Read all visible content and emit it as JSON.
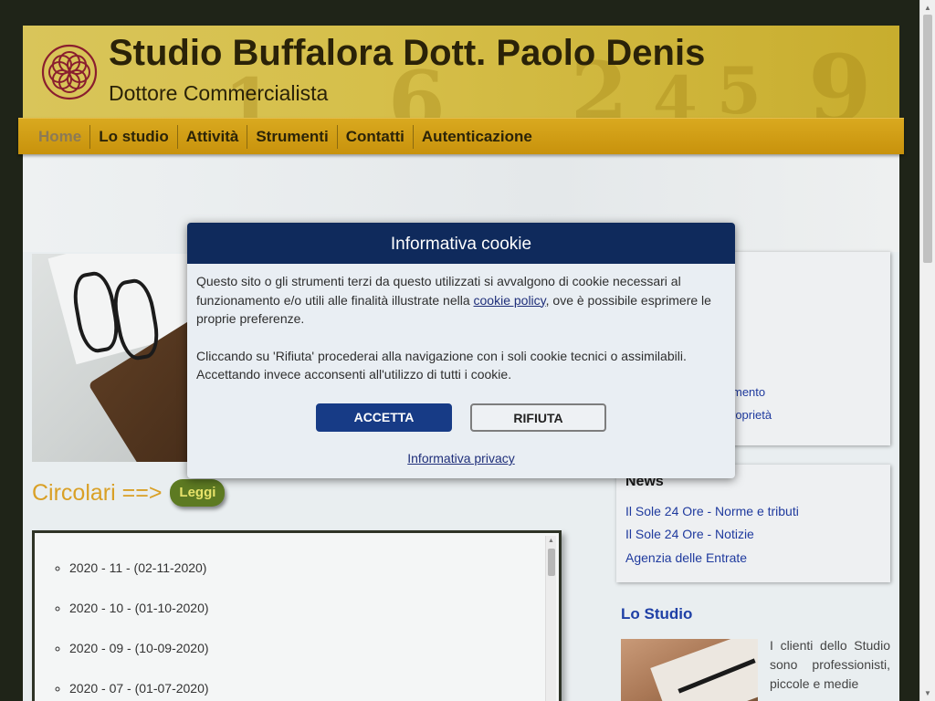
{
  "header": {
    "title": "Studio Buffalora Dott. Paolo Denis",
    "subtitle": "Dottore Commercialista"
  },
  "nav": {
    "items": [
      "Home",
      "Lo studio",
      "Attività",
      "Strumenti",
      "Contatti",
      "Autenticazione"
    ],
    "active": "Home"
  },
  "circolari": {
    "title": "Circolari ==>",
    "button": "Leggi",
    "items": [
      "2020 - 11 - (02-11-2020)",
      "2020 - 10 - (01-10-2020)",
      "2020 - 09 - (10-09-2020)",
      "2020 - 07 - (01-07-2020)"
    ]
  },
  "side_panel": {
    "links": [
      "mento",
      "roprietà"
    ]
  },
  "news": {
    "title": "News",
    "links": [
      "Il Sole 24 Ore - Norme e tributi",
      "Il Sole 24 Ore - Notizie",
      "Agenzia delle Entrate"
    ]
  },
  "lo_studio": {
    "title": "Lo Studio",
    "text": "I clienti dello Studio sono professionisti, piccole e medie"
  },
  "cookie": {
    "title": "Informativa cookie",
    "p1_before": "Questo sito o gli strumenti terzi da questo utilizzati si avvalgono di cookie necessari al funzionamento e/o utili alle finalità illustrate nella ",
    "p1_link": "cookie policy",
    "p1_after": ", ove è possibile esprimere le proprie preferenze.",
    "p2": "Cliccando su 'Rifiuta' procederai alla navigazione con i soli cookie tecnici o assimilabili. Accettando invece acconsenti all'utilizzo di tutti i cookie.",
    "accept": "ACCETTA",
    "reject": "RIFIUTA",
    "privacy": "Informativa privacy"
  },
  "colors": {
    "header_gold": "#d6bf4a",
    "nav_gold": "#c8920c",
    "dialog_navy": "#0f2a5c",
    "accept_blue": "#173b86",
    "circolari_orange": "#d9a026",
    "leggi_green": "#5d7a22",
    "link_blue": "#1f3a9e"
  }
}
